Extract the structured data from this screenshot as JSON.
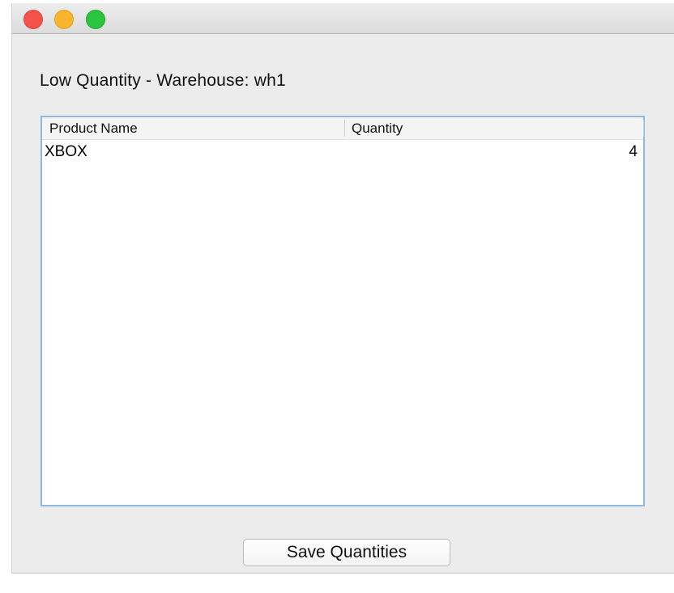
{
  "window": {
    "controls": {
      "close_color": "#f4514a",
      "minimize_color": "#f7b52d",
      "zoom_color": "#2ac43f"
    }
  },
  "heading": "Low Quantity - Warehouse: wh1",
  "table": {
    "columns": [
      "Product Name",
      "Quantity"
    ],
    "rows": [
      {
        "product_name": "XBOX",
        "quantity": "4"
      }
    ]
  },
  "actions": {
    "save_label": "Save Quantities"
  },
  "colors": {
    "table_border": "#8fb8e0",
    "window_bg": "#ececec"
  }
}
